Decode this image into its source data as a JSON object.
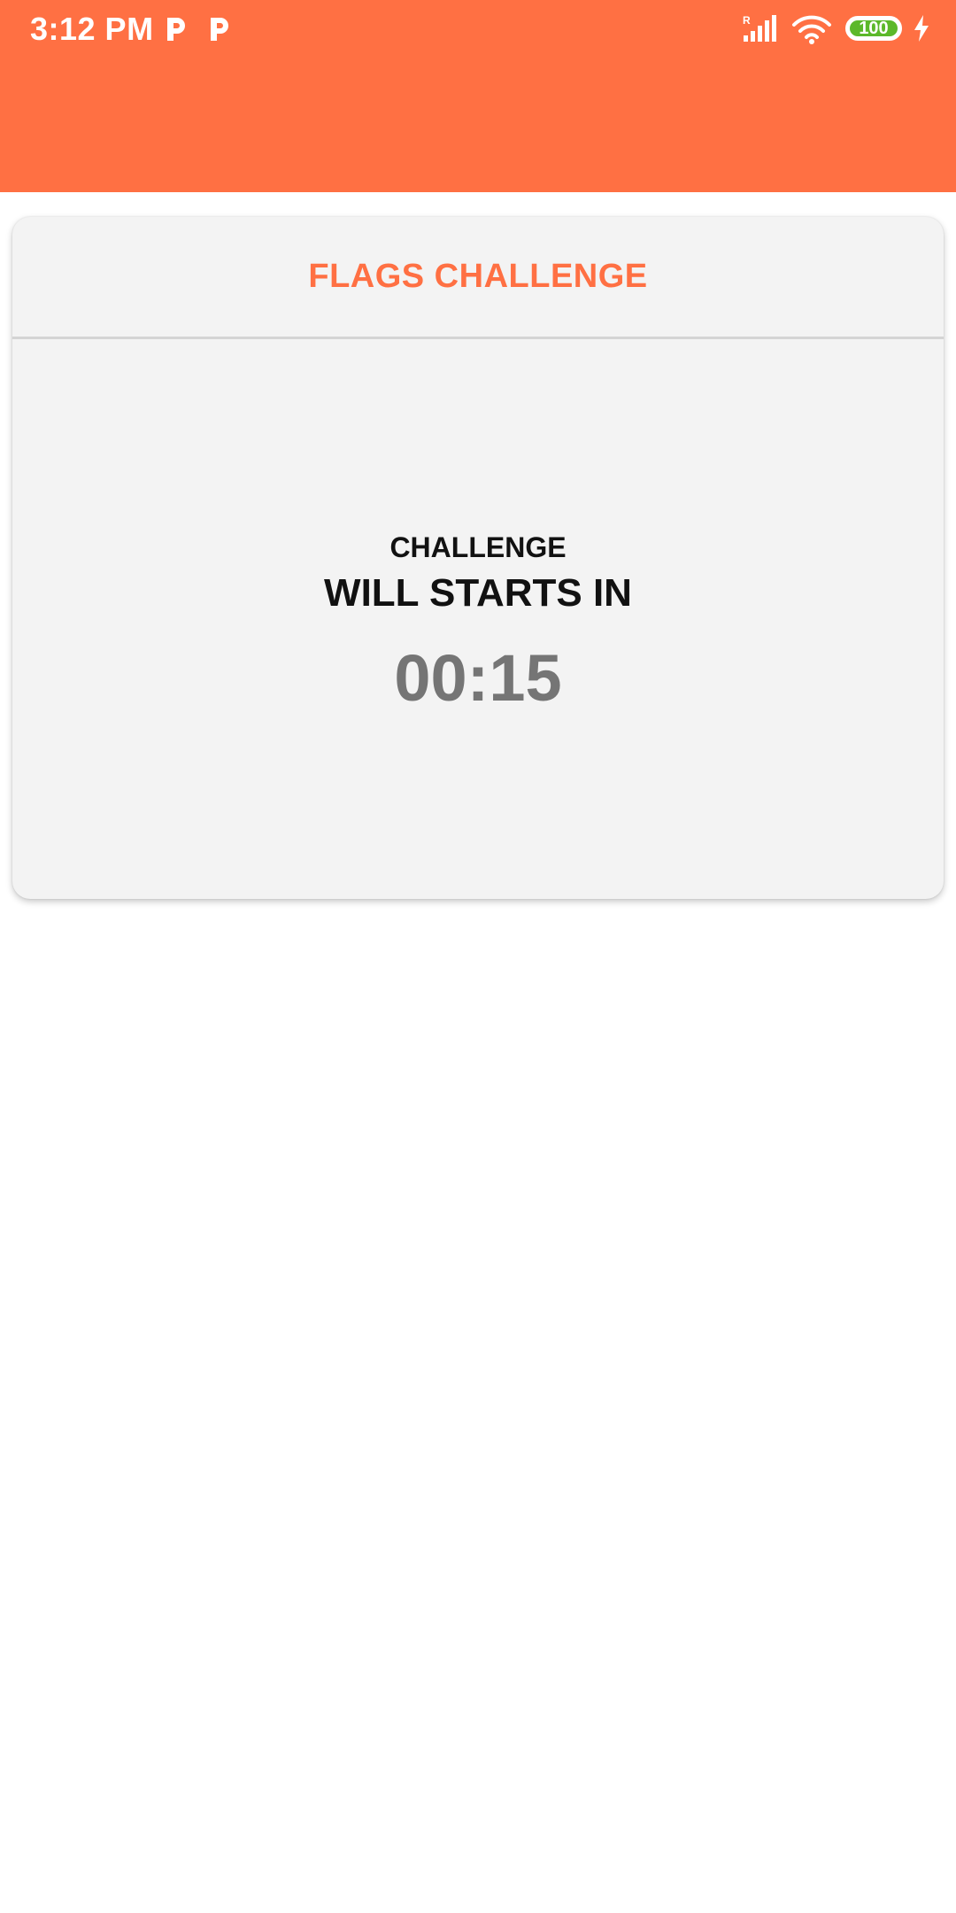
{
  "status_bar": {
    "time": "3:12 PM",
    "notification_icons": [
      "parking-app-icon",
      "parking-app-icon"
    ],
    "signal_badge": "R",
    "battery_level": "100",
    "charging": true
  },
  "app_bar": {
    "color": "#FF7043"
  },
  "card": {
    "title": "FLAGS CHALLENGE",
    "line1": "CHALLENGE",
    "line2": "WILL STARTS IN",
    "countdown": "00:15"
  },
  "colors": {
    "accent": "#FF7043",
    "battery": "#5CB82A",
    "countdown": "#757575"
  }
}
